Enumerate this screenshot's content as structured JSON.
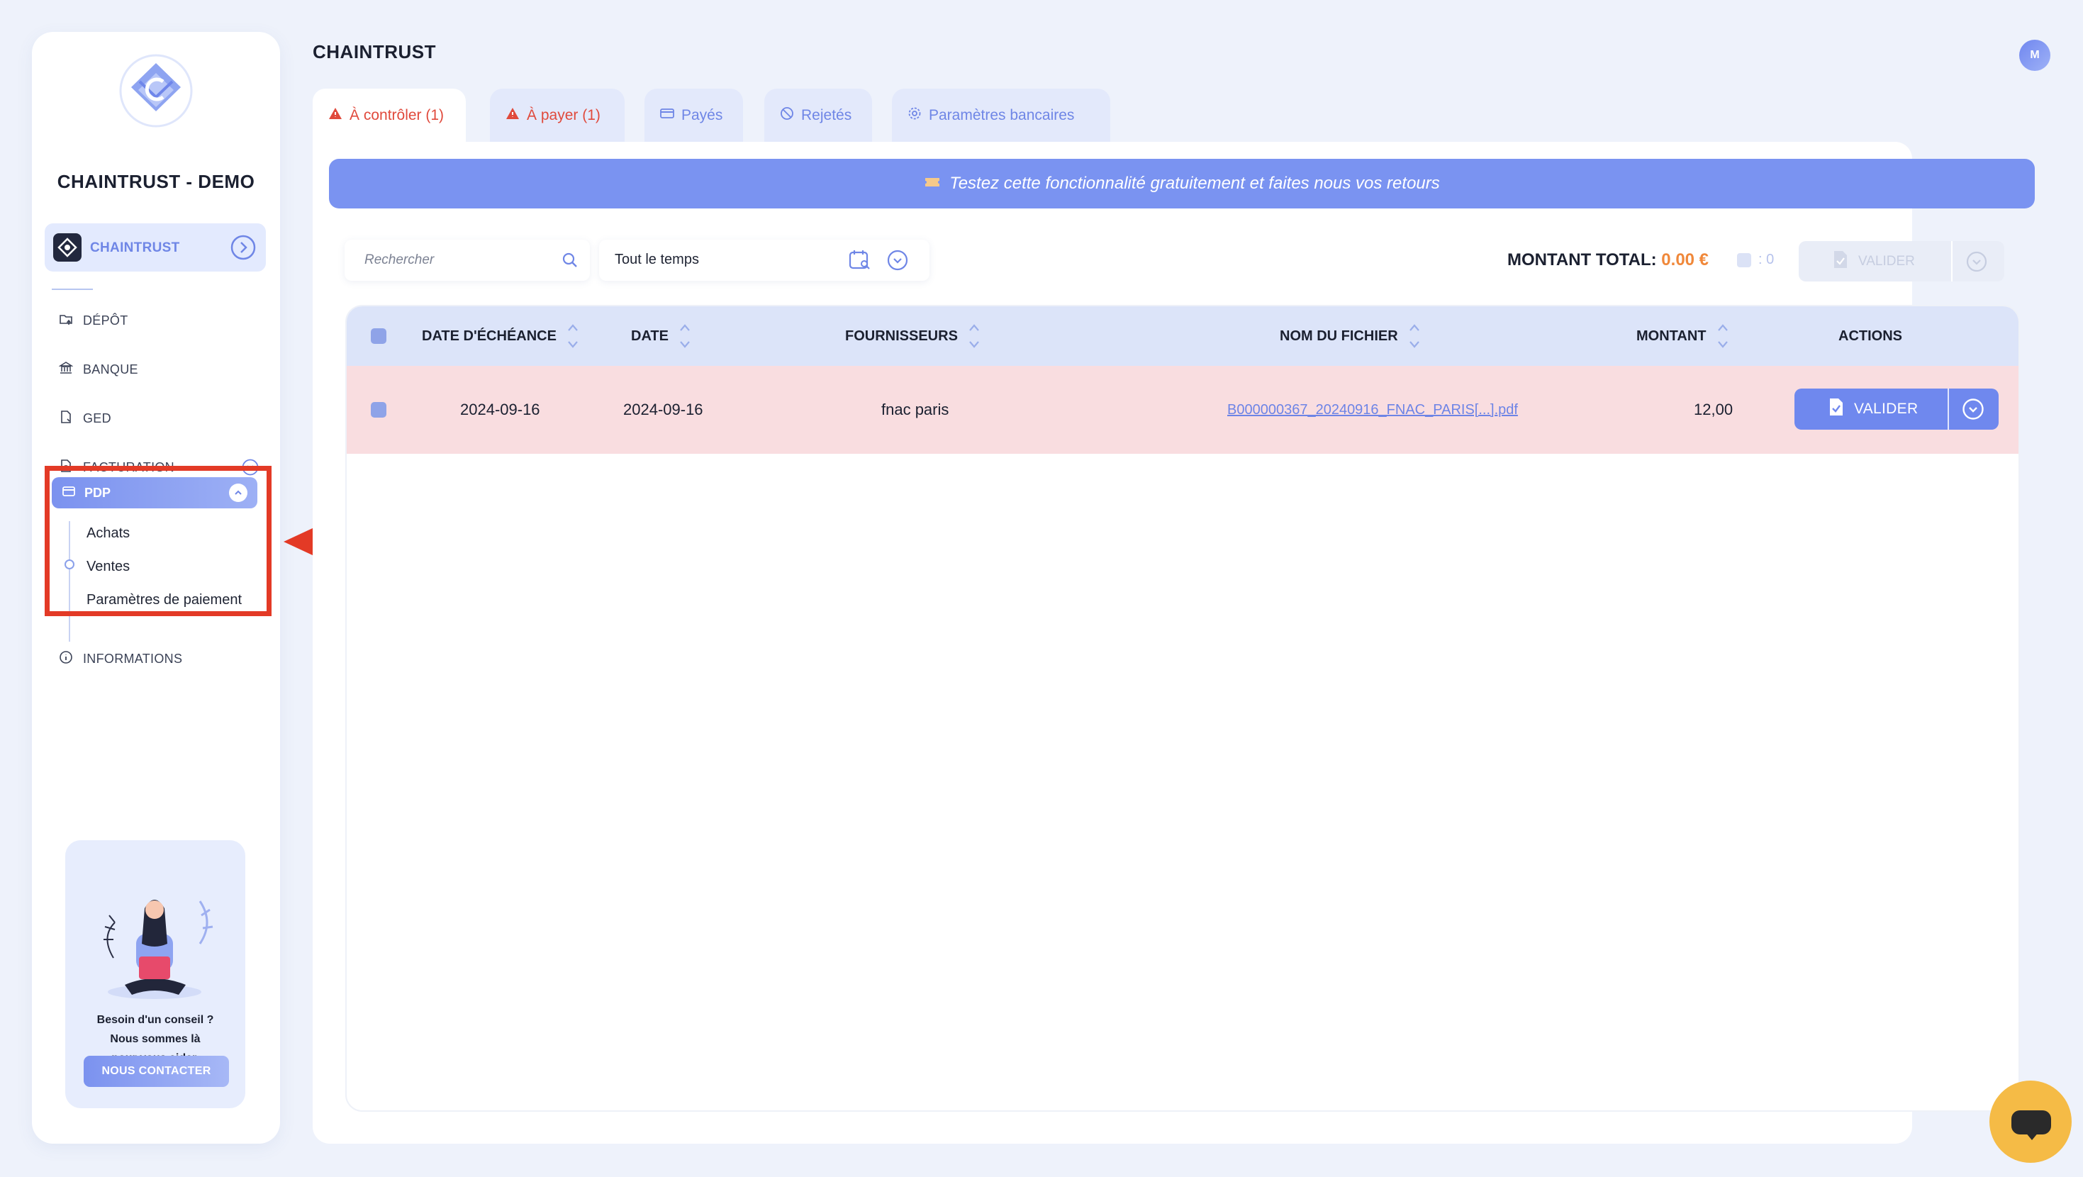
{
  "app": {
    "company_name": "CHAINTRUST - DEMO",
    "page_title": "CHAINTRUST",
    "user_initial": "M"
  },
  "sidebar": {
    "org_label": "CHAINTRUST",
    "nav": [
      {
        "label": "DÉPÔT",
        "icon": "folder-upload-icon"
      },
      {
        "label": "BANQUE",
        "icon": "bank-icon"
      },
      {
        "label": "GED",
        "icon": "document-icon"
      },
      {
        "label": "FACTURATION",
        "icon": "invoice-icon"
      }
    ],
    "pdp": {
      "label": "PDP",
      "icon": "credit-card-icon",
      "subitems": [
        "Achats",
        "Ventes",
        "Paramètres de paiement"
      ]
    },
    "informations_label": "INFORMATIONS",
    "help": {
      "line1": "Besoin d'un conseil ?",
      "line2": "Nous sommes là",
      "line3": "pour vous aider.",
      "button": "NOUS CONTACTER"
    }
  },
  "tabs": [
    {
      "label": "À contrôler (1)",
      "icon": "warning-icon",
      "active": true,
      "warn": true
    },
    {
      "label": "À payer (1)",
      "icon": "warning-icon",
      "active": false,
      "warn": true
    },
    {
      "label": "Payés",
      "icon": "card-icon",
      "active": false,
      "warn": false
    },
    {
      "label": "Rejetés",
      "icon": "ban-icon",
      "active": false,
      "warn": false
    },
    {
      "label": "Paramètres bancaires",
      "icon": "gear-icon",
      "active": false,
      "warn": false
    }
  ],
  "banner": {
    "text": "Testez cette fonctionnalité gratuitement et faites nous vos retours"
  },
  "toolbar": {
    "search_placeholder": "Rechercher",
    "period": "Tout le temps",
    "total_label": "MONTANT TOTAL:",
    "total_value": "0.00 €",
    "selected_count": ": 0",
    "bulk_validate": "VALIDER"
  },
  "table": {
    "columns": [
      "DATE D'ÉCHÉANCE",
      "DATE",
      "FOURNISSEURS",
      "NOM DU FICHIER",
      "MONTANT",
      "ACTIONS"
    ],
    "rows": [
      {
        "due_date": "2024-09-16",
        "date": "2024-09-16",
        "supplier": "fnac paris",
        "file_name": "B000000367_20240916_FNAC_PARIS[...].pdf",
        "amount": "12,00",
        "action": "VALIDER"
      }
    ]
  },
  "colors": {
    "accent": "#6f88ee",
    "warning": "#e04a3c",
    "highlight": "#e33a26",
    "total_amount": "#f0883a",
    "row_highlight": "#f9dde0",
    "chat": "#f5bb46"
  }
}
